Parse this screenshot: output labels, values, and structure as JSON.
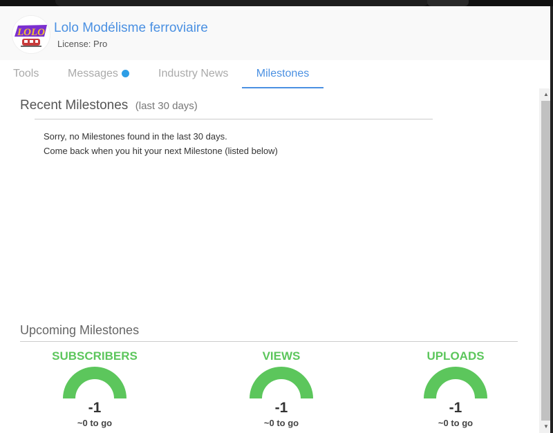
{
  "header": {
    "logo_text": "LOLO",
    "title": "Lolo Modélisme ferroviaire",
    "license_label": "License:",
    "license_value": "Pro"
  },
  "tabs": [
    {
      "label": "Tools"
    },
    {
      "label": "Messages",
      "badge": true
    },
    {
      "label": "Industry News"
    },
    {
      "label": "Milestones",
      "active": true
    }
  ],
  "recent": {
    "title": "Recent Milestones",
    "subtitle": "(last 30 days)",
    "message_line1": "Sorry, no Milestones found in the last 30 days.",
    "message_line2": "Come back when you hit your next Milestone (listed below)"
  },
  "upcoming": {
    "title": "Upcoming Milestones",
    "items": [
      {
        "label": "SUBSCRIBERS",
        "value": "-1",
        "to_go": "~0 to go"
      },
      {
        "label": "VIEWS",
        "value": "-1",
        "to_go": "~0 to go"
      },
      {
        "label": "UPLOADS",
        "value": "-1",
        "to_go": "~0 to go"
      }
    ]
  },
  "colors": {
    "accent": "#4a90e2",
    "milestone_green": "#5cc65c",
    "badge_blue": "#2d9ee6"
  },
  "icons": {
    "messages_badge": "dot-icon",
    "scroll_up": "arrow-up-icon",
    "scroll_down": "arrow-down-icon"
  }
}
